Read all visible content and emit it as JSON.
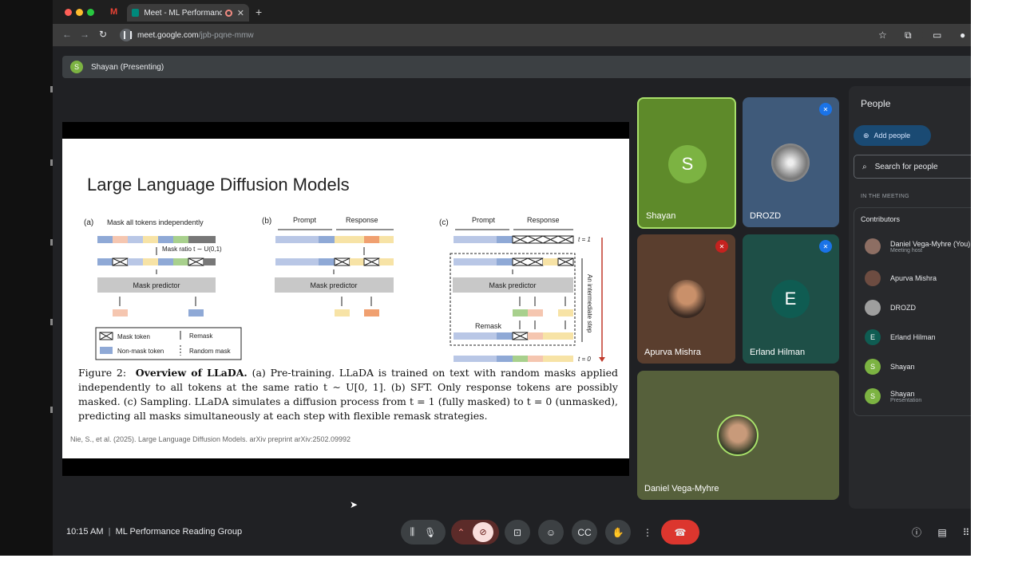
{
  "browser": {
    "tab_gmail_label": "M",
    "tab_title": "Meet - ML Performance R",
    "tab_close": "✕",
    "newtab": "+",
    "url_host": "meet.google.com",
    "url_path": "/jpb-pqne-mmw"
  },
  "banner": {
    "presenter_initial": "S",
    "text": "Shayan (Presenting)"
  },
  "slide": {
    "title": "Large Language Diffusion Models",
    "figure": {
      "panel_a": {
        "label": "(a)",
        "header": "Mask all tokens independently",
        "mask_ratio": "Mask ratio t ∼ U(0,1)",
        "predictor": "Mask predictor"
      },
      "panel_b": {
        "label": "(b)",
        "prompt": "Prompt",
        "response": "Response",
        "predictor": "Mask predictor"
      },
      "panel_c": {
        "label": "(c)",
        "prompt": "Prompt",
        "response": "Response",
        "predictor": "Mask predictor",
        "remask": "Remask",
        "t1": "t = 1",
        "t0": "t = 0",
        "side": "An intermediate step"
      },
      "legend": {
        "mask_token": "Mask token",
        "non_mask_token": "Non-mask token",
        "remask": "Remask",
        "random_mask": "Random mask"
      }
    },
    "caption_label": "Figure 2:",
    "caption_bold": "Overview of LLaDA.",
    "caption_text": "(a) Pre-training. LLaDA is trained on text with random masks applied independently to all tokens at the same ratio t ∼ U[0, 1]. (b) SFT. Only response tokens are possibly masked. (c) Sampling. LLaDA simulates a diffusion process from t = 1 (fully masked) to t = 0 (unmasked), predicting all masks simultaneously at each step with flexible remask strategies.",
    "citation": "Nie, S., et al. (2025). Large Language Diffusion Models. arXiv preprint arXiv:2502.09992"
  },
  "tiles": [
    {
      "name": "Shayan",
      "initial": "S",
      "bg": "#5e8a2a",
      "avatar_bg": "#7cb342"
    },
    {
      "name": "DROZD",
      "initial": "",
      "bg": "#3f5a7a"
    },
    {
      "name": "Apurva Mishra",
      "initial": "",
      "bg": "#5a3e2e"
    },
    {
      "name": "Erland Hilman",
      "initial": "E",
      "bg": "#1e4f47",
      "avatar_bg": "#0f5c52"
    },
    {
      "name": "Daniel Vega-Myhre",
      "initial": "",
      "bg": "#56603b"
    }
  ],
  "people": {
    "title": "People",
    "add_label": "Add people",
    "search_placeholder": "Search for people",
    "in_meeting": "IN THE MEETING",
    "contributors": "Contributors",
    "list": [
      {
        "name": "Daniel Vega-Myhre (You)",
        "sub": "Meeting host",
        "initial": "",
        "color": "#8d6e63"
      },
      {
        "name": "Apurva Mishra",
        "sub": "",
        "initial": "",
        "color": "#6d4c41"
      },
      {
        "name": "DROZD",
        "sub": "",
        "initial": "",
        "color": "#9e9e9e"
      },
      {
        "name": "Erland Hilman",
        "sub": "",
        "initial": "E",
        "color": "#0f5c52"
      },
      {
        "name": "Shayan",
        "sub": "",
        "initial": "S",
        "color": "#7cb342"
      },
      {
        "name": "Shayan",
        "sub": "Presentation",
        "initial": "S",
        "color": "#7cb342"
      }
    ]
  },
  "footer": {
    "time": "10:15 AM",
    "separator": "|",
    "meeting_name": "ML Performance Reading Group"
  },
  "colors": {
    "accent_green": "#a8e06a",
    "end_call_red": "#dc362e",
    "mute_blue": "#1a73e8",
    "mute_red": "#c5221f"
  }
}
